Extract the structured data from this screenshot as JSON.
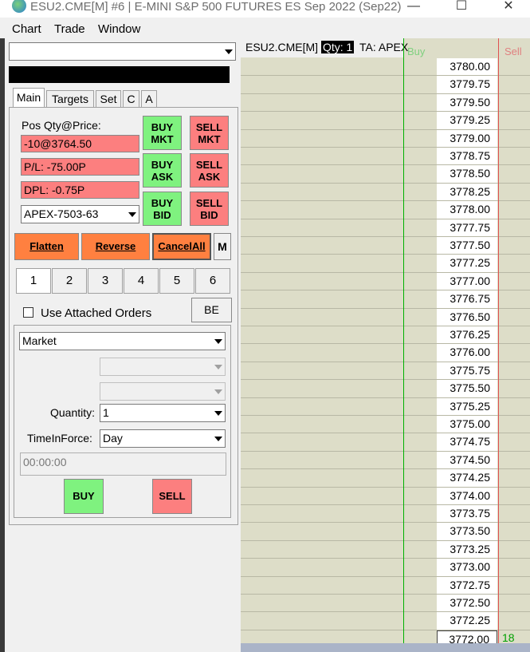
{
  "window": {
    "title": "ESU2.CME[M]  #6 | E-MINI S&P 500 FUTURES ES Sep 2022 (Sep22)",
    "controls": [
      "—",
      "☐",
      "✕"
    ]
  },
  "menu": [
    "Chart",
    "Trade",
    "Window"
  ],
  "order_panel": {
    "account_combo_value": "",
    "tabs": [
      "Main",
      "Targets",
      "Set",
      "C",
      "A"
    ],
    "active_tab": "Main",
    "pos_label": "Pos Qty@Price:",
    "position": "-10@3764.50",
    "pl": "P/L: -75.00P",
    "dpl": "DPL: -0.75P",
    "account": "APEX-7503-63",
    "buy_mkt": [
      "BUY",
      "MKT"
    ],
    "sell_mkt": [
      "SELL",
      "MKT"
    ],
    "buy_ask": [
      "BUY",
      "ASK"
    ],
    "sell_ask": [
      "SELL",
      "ASK"
    ],
    "buy_bid": [
      "BUY",
      "BID"
    ],
    "sell_bid": [
      "SELL",
      "BID"
    ],
    "flatten": "Flatten",
    "reverse": "Reverse",
    "cancel_all": "CancelAll",
    "m_button": "M",
    "qty_presets": [
      "1",
      "2",
      "3",
      "4",
      "5",
      "6"
    ],
    "use_attached_orders": "Use Attached Orders",
    "use_attached_orders_checked": false,
    "be_button": "BE",
    "order_type": "Market",
    "quantity_label": "Quantity:",
    "quantity": "1",
    "tif_label": "TimeInForce:",
    "tif": "Day",
    "time_field": "00:00:00",
    "buy": "BUY",
    "sell": "SELL"
  },
  "ladder": {
    "symbol": "ESU2.CME[M]",
    "qty_label": "Qty: 1",
    "ta_label": "TA: APEX",
    "buy_col": "Buy",
    "sell_col": "Sell",
    "prices": [
      "3780.00",
      "3779.75",
      "3779.50",
      "3779.25",
      "3779.00",
      "3778.75",
      "3778.50",
      "3778.25",
      "3778.00",
      "3777.75",
      "3777.50",
      "3777.25",
      "3777.00",
      "3776.75",
      "3776.50",
      "3776.25",
      "3776.00",
      "3775.75",
      "3775.50",
      "3775.25",
      "3775.00",
      "3774.75",
      "3774.50",
      "3774.25",
      "3774.00",
      "3773.75",
      "3773.50",
      "3773.25",
      "3773.00",
      "3772.75",
      "3772.50",
      "3772.25",
      "3772.00"
    ],
    "last_price": "3772.00",
    "last_size": "18",
    "colors": {
      "buy": "#00a000",
      "sell": "#e07070",
      "cell_bg": "#ddddc8"
    }
  }
}
